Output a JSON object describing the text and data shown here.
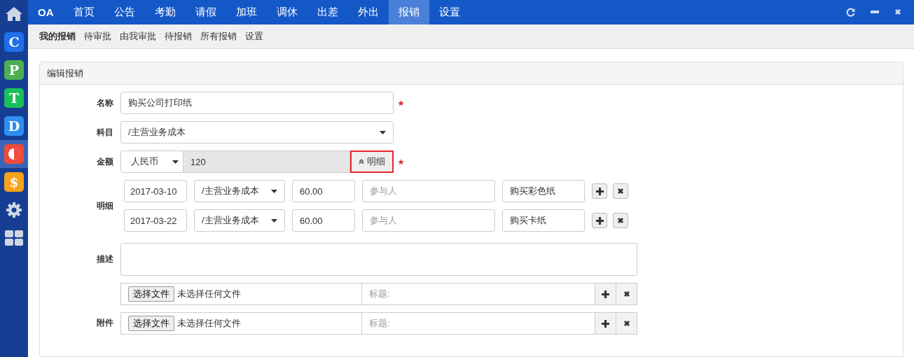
{
  "sidebar": {
    "apps": [
      {
        "kind": "home",
        "selected": false
      },
      {
        "kind": "letter",
        "label": "C",
        "color": "#1f6fe8",
        "selected": false
      },
      {
        "kind": "letter",
        "label": "P",
        "color": "#4caf50",
        "selected": false
      },
      {
        "kind": "letter",
        "label": "T",
        "color": "#19c05a",
        "selected": false
      },
      {
        "kind": "letter",
        "label": "D",
        "color": "#2f8ff0",
        "selected": false
      },
      {
        "kind": "half",
        "color": "#ef4a3c",
        "selected": true
      },
      {
        "kind": "letter",
        "label": "$",
        "color": "#f7a21b",
        "selected": false
      },
      {
        "kind": "gear",
        "selected": false
      },
      {
        "kind": "grid",
        "selected": false
      }
    ]
  },
  "topbar": {
    "logo": "OA",
    "tabs": [
      {
        "label": "首页",
        "selected": false
      },
      {
        "label": "公告",
        "selected": false
      },
      {
        "label": "考勤",
        "selected": false
      },
      {
        "label": "请假",
        "selected": false
      },
      {
        "label": "加班",
        "selected": false
      },
      {
        "label": "调休",
        "selected": false
      },
      {
        "label": "出差",
        "selected": false
      },
      {
        "label": "外出",
        "selected": false
      },
      {
        "label": "报销",
        "selected": true
      },
      {
        "label": "设置",
        "selected": false
      }
    ]
  },
  "subnav": [
    {
      "label": "我的报销",
      "selected": true
    },
    {
      "label": "待审批",
      "selected": false
    },
    {
      "label": "由我审批",
      "selected": false
    },
    {
      "label": "待报销",
      "selected": false
    },
    {
      "label": "所有报销",
      "selected": false
    },
    {
      "label": "设置",
      "selected": false
    }
  ],
  "panel": {
    "title": "编辑报销",
    "name": {
      "label": "名称",
      "value": "购买公司打印纸",
      "required": true
    },
    "subject": {
      "label": "科目",
      "value": "/主营业务成本"
    },
    "amount": {
      "label": "金额",
      "currency": "人民币",
      "value": "120",
      "detail_button": "明细",
      "required": true
    },
    "details": {
      "label": "明细",
      "rows": [
        {
          "date": "2017-03-10",
          "subject": "/主营业务成本",
          "amount": "60.00",
          "participants_placeholder": "参与人",
          "note": "购买彩色纸"
        },
        {
          "date": "2017-03-22",
          "subject": "/主营业务成本",
          "amount": "60.00",
          "participants_placeholder": "参与人",
          "note": "购买卡纸"
        }
      ]
    },
    "description": {
      "label": "描述"
    },
    "attachments": {
      "label": "附件",
      "rows": [
        {
          "choose_button": "选择文件",
          "file_status": "未选择任何文件",
          "title_placeholder": "标题:"
        },
        {
          "choose_button": "选择文件",
          "file_status": "未选择任何文件",
          "title_placeholder": "标题:"
        }
      ]
    }
  }
}
